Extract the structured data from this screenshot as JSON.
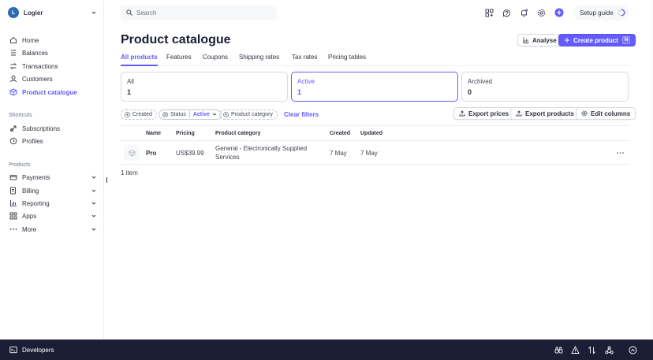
{
  "account": {
    "name": "Logier",
    "logo_letter": "L"
  },
  "sidebar": {
    "main_items": [
      {
        "label": "Home",
        "icon": "home-icon"
      },
      {
        "label": "Balances",
        "icon": "balances-icon"
      },
      {
        "label": "Transactions",
        "icon": "transactions-icon"
      },
      {
        "label": "Customers",
        "icon": "customers-icon"
      },
      {
        "label": "Product catalogue",
        "icon": "product-catalogue-icon",
        "active": true
      }
    ],
    "shortcuts_label": "Shortcuts",
    "shortcuts": [
      {
        "label": "Subscriptions",
        "icon": "subscriptions-icon"
      },
      {
        "label": "Profiles",
        "icon": "profiles-icon"
      }
    ],
    "products_label": "Products",
    "products": [
      {
        "label": "Payments",
        "icon": "payments-icon"
      },
      {
        "label": "Billing",
        "icon": "billing-icon"
      },
      {
        "label": "Reporting",
        "icon": "reporting-icon"
      },
      {
        "label": "Apps",
        "icon": "apps-icon"
      },
      {
        "label": "More",
        "icon": "more-icon"
      }
    ]
  },
  "topbar": {
    "search_placeholder": "Search",
    "setup_guide": "Setup guide"
  },
  "page": {
    "title": "Product catalogue",
    "analyse_label": "Analyse",
    "create_label": "Create product",
    "create_shortcut": "N"
  },
  "tabs": [
    "All products",
    "Features",
    "Coupons",
    "Shipping rates",
    "Tax rates",
    "Pricing tables"
  ],
  "cards": [
    {
      "label": "All",
      "value": "1"
    },
    {
      "label": "Active",
      "value": "1"
    },
    {
      "label": "Archived",
      "value": "0"
    }
  ],
  "filters": {
    "created": "Created",
    "status": "Status",
    "status_value": "Active",
    "category": "Product category",
    "clear": "Clear filters",
    "export_prices": "Export prices",
    "export_products": "Export products",
    "edit_columns": "Edit columns"
  },
  "table": {
    "headers": {
      "name": "Name",
      "pricing": "Pricing",
      "category": "Product category",
      "created": "Created",
      "updated": "Updated"
    },
    "rows": [
      {
        "name": "Pro",
        "pricing": "US$39.99",
        "category_line1": "General - Electronically Supplied",
        "category_line2": "Services",
        "created": "7 May",
        "updated": "7 May"
      }
    ],
    "count": "1 item"
  },
  "bottombar": {
    "developers": "Developers"
  },
  "colors": {
    "accent": "#635bff",
    "bottom_bar": "#1a1f36",
    "text": "#30313d"
  }
}
